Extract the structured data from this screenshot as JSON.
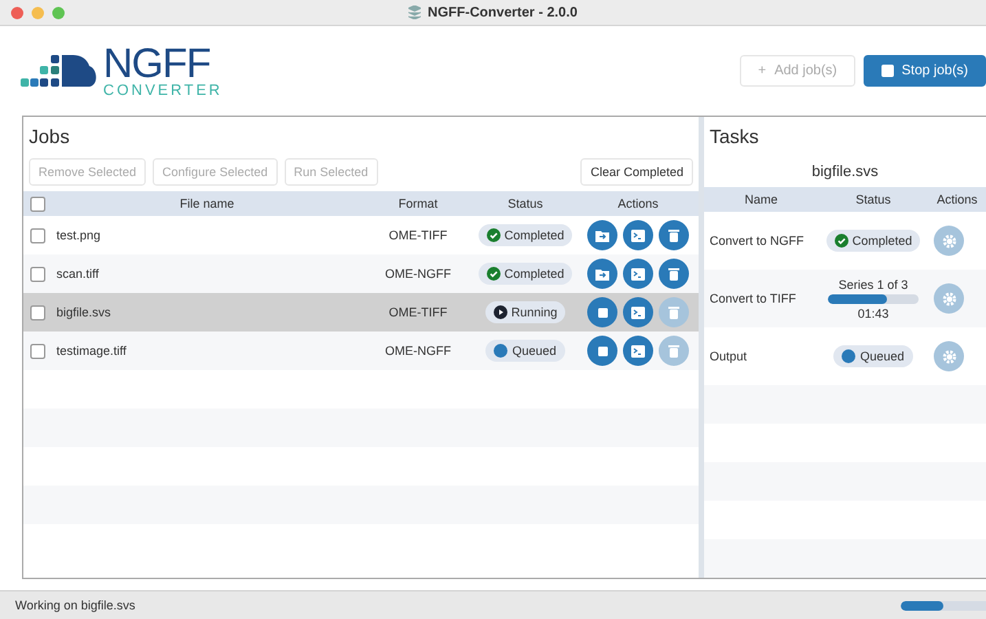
{
  "window": {
    "title": "NGFF-Converter - 2.0.0"
  },
  "logo": {
    "name": "NGFF",
    "subtitle": "CONVERTER"
  },
  "toolbar": [
    {
      "label": "Add job(s)",
      "icon": "+",
      "disabled": true,
      "primary": false
    },
    {
      "label": "Stop job(s)",
      "disabled": false,
      "primary": true
    }
  ],
  "jobs": {
    "title": "Jobs",
    "buttons": [
      {
        "label": "Remove Selected",
        "disabled": true
      },
      {
        "label": "Configure Selected",
        "disabled": true
      },
      {
        "label": "Run Selected",
        "disabled": true
      }
    ],
    "clear_button": {
      "label": "Clear Completed",
      "disabled": false
    },
    "select_all": {
      "checked": false
    },
    "columns": [
      "File name",
      "Format",
      "Status",
      "Actions"
    ],
    "rows": [
      {
        "name": "test.png",
        "format": "OME-TIFF",
        "status": {
          "kind": "completed",
          "label": "Completed"
        },
        "checked": false,
        "selected": false,
        "actions": [
          {
            "kind": "folder",
            "disabled": false
          },
          {
            "kind": "terminal",
            "disabled": false
          },
          {
            "kind": "trash",
            "disabled": false
          }
        ]
      },
      {
        "name": "scan.tiff",
        "format": "OME-NGFF",
        "status": {
          "kind": "completed",
          "label": "Completed"
        },
        "checked": false,
        "selected": false,
        "actions": [
          {
            "kind": "folder",
            "disabled": false
          },
          {
            "kind": "terminal",
            "disabled": false
          },
          {
            "kind": "trash",
            "disabled": false
          }
        ]
      },
      {
        "name": "bigfile.svs",
        "format": "OME-TIFF",
        "status": {
          "kind": "running",
          "label": "Running"
        },
        "checked": false,
        "selected": true,
        "actions": [
          {
            "kind": "stop",
            "disabled": false
          },
          {
            "kind": "terminal",
            "disabled": false
          },
          {
            "kind": "trash",
            "disabled": true
          }
        ]
      },
      {
        "name": "testimage.tiff",
        "format": "OME-NGFF",
        "status": {
          "kind": "queued",
          "label": "Queued"
        },
        "checked": false,
        "selected": false,
        "actions": [
          {
            "kind": "stop",
            "disabled": false
          },
          {
            "kind": "terminal",
            "disabled": false
          },
          {
            "kind": "trash",
            "disabled": true
          }
        ]
      }
    ]
  },
  "tasks": {
    "title": "Tasks",
    "file": "bigfile.svs",
    "columns": [
      "Name",
      "Status",
      "Actions"
    ],
    "rows": [
      {
        "name": "Convert to NGFF",
        "status": {
          "kind": "completed",
          "label": "Completed"
        }
      },
      {
        "name": "Convert to TIFF",
        "status": {
          "kind": "progress",
          "label": "Series 1 of 3",
          "level": 0.65,
          "time": "01:43"
        }
      },
      {
        "name": "Output",
        "status": {
          "kind": "queued",
          "label": "Queued"
        }
      }
    ]
  },
  "status_bar": {
    "text": "Working on bigfile.svs",
    "level": 0.5
  }
}
